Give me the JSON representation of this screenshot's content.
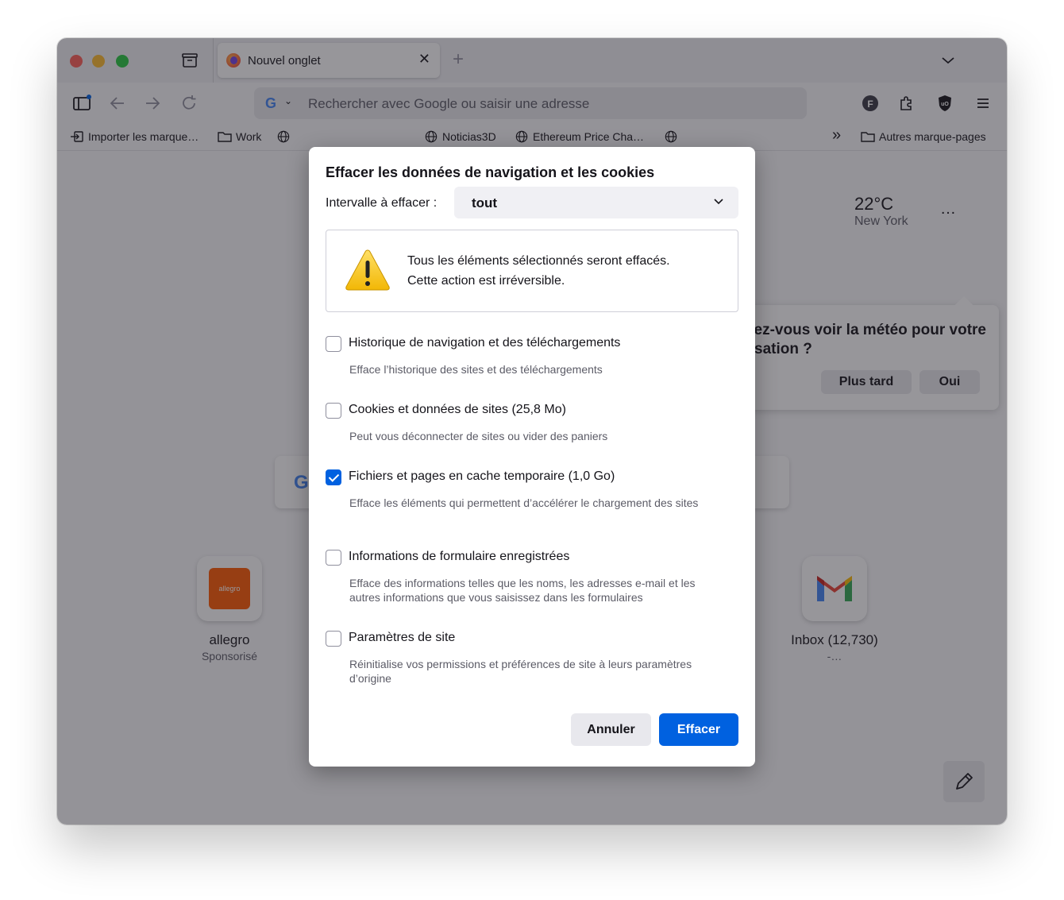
{
  "tab": {
    "title": "Nouvel onglet",
    "close": "✕",
    "new": "+"
  },
  "urlbar": {
    "engine": "G",
    "placeholder": "Rechercher avec Google ou saisir une adresse"
  },
  "bookmarks": {
    "import": "Importer les marque…",
    "work": "Work",
    "noticias": "Noticias3D",
    "ethereum": "Ethereum Price Cha…",
    "overflow": "»",
    "other": "Autres marque-pages"
  },
  "weather": {
    "temp": "22°C",
    "city": "New York",
    "menu": "…",
    "prompt_line1": "ez-vous voir la météo pour votre",
    "prompt_line2": "sation ?",
    "later": "Plus tard",
    "yes": "Oui"
  },
  "shortcuts": [
    {
      "label": "allegro",
      "sub": "Sponsorisé",
      "logo_text": "allegro"
    },
    {
      "label": "Inbox (12,730)",
      "sub": "-…"
    }
  ],
  "dialog": {
    "title": "Effacer les données de navigation et les cookies",
    "range_label": "Intervalle à effacer :",
    "range_value": "tout",
    "warning_line1": "Tous les éléments sélectionnés seront effacés.",
    "warning_line2": "Cette action est irréversible.",
    "options": [
      {
        "label": "Historique de navigation et des téléchargements",
        "desc": "Efface l’historique des sites et des téléchargements",
        "checked": false
      },
      {
        "label": "Cookies et données de sites (25,8 Mo)",
        "desc": "Peut vous déconnecter de sites ou vider des paniers",
        "checked": false
      },
      {
        "label": "Fichiers et pages en cache temporaire (1,0 Go)",
        "desc": "Efface les éléments qui permettent d’accélérer le chargement des sites",
        "checked": true
      },
      {
        "label": "Informations de formulaire enregistrées",
        "desc": "Efface des informations telles que les noms, les adresses e-mail et les autres informations que vous saisissez dans les formulaires",
        "checked": false
      },
      {
        "label": "Paramètres de site",
        "desc": "Réinitialise vos permissions et préférences de site à leurs paramètres d’origine",
        "checked": false
      }
    ],
    "cancel": "Annuler",
    "clear": "Effacer"
  },
  "colors": {
    "accent": "#0061e0",
    "overlay": "rgba(33,32,40,0.47)"
  }
}
